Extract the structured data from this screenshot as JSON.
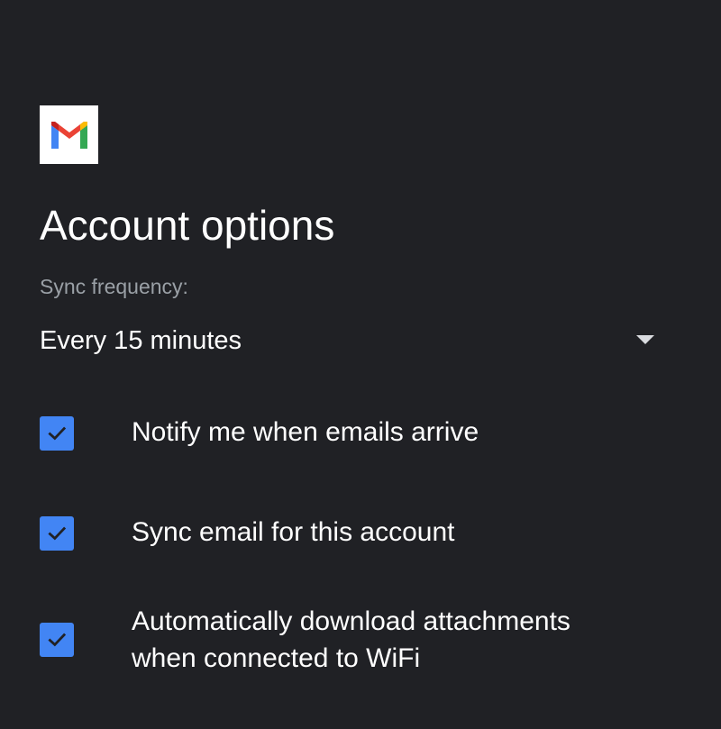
{
  "app": {
    "logo_icon": "gmail-logo-icon",
    "logo_colors": {
      "red": "#EA4335",
      "blue": "#4285F4",
      "green": "#34A853",
      "yellow": "#FBBC04",
      "dark_red": "#C5221F"
    }
  },
  "header": {
    "title": "Account options"
  },
  "sync": {
    "label": "Sync frequency:",
    "selected": "Every 15 minutes",
    "arrow_icon": "dropdown-arrow-icon"
  },
  "options": [
    {
      "label": "Notify me when emails arrive",
      "checked": true
    },
    {
      "label": "Sync email for this account",
      "checked": true
    },
    {
      "label_line1": "Automatically download attachments",
      "label_line2": "when connected to WiFi",
      "checked": true
    }
  ],
  "colors": {
    "background": "#202125",
    "checkbox": "#4285F4",
    "text_primary": "#FFFFFF",
    "text_secondary": "#9AA0A6"
  }
}
